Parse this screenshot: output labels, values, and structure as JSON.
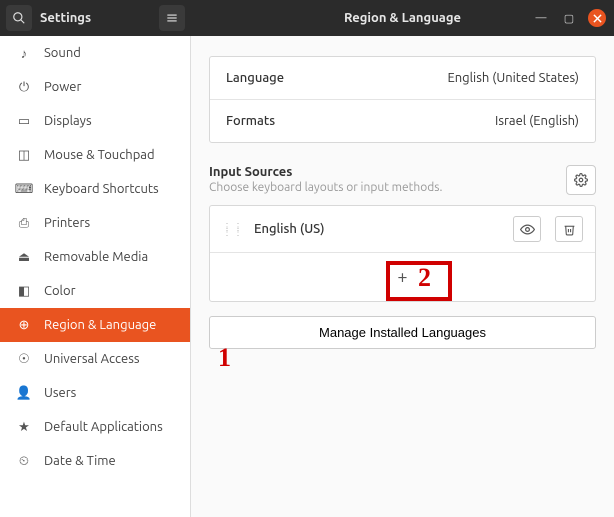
{
  "header": {
    "left_title": "Settings",
    "right_title": "Region & Language"
  },
  "sidebar": {
    "items": [
      {
        "icon": "♪",
        "label": "Sound"
      },
      {
        "icon": "⏻",
        "label": "Power"
      },
      {
        "icon": "▭",
        "label": "Displays"
      },
      {
        "icon": "◫",
        "label": "Mouse & Touchpad"
      },
      {
        "icon": "⌨",
        "label": "Keyboard Shortcuts"
      },
      {
        "icon": "⎙",
        "label": "Printers"
      },
      {
        "icon": "⏏",
        "label": "Removable Media"
      },
      {
        "icon": "◧",
        "label": "Color"
      },
      {
        "icon": "⊕",
        "label": "Region & Language"
      },
      {
        "icon": "☉",
        "label": "Universal Access"
      },
      {
        "icon": "👤",
        "label": "Users"
      },
      {
        "icon": "★",
        "label": "Default Applications"
      },
      {
        "icon": "⏲",
        "label": "Date & Time"
      }
    ],
    "active_index": 8
  },
  "settings": {
    "language": {
      "label": "Language",
      "value": "English (United States)"
    },
    "formats": {
      "label": "Formats",
      "value": "Israel (English)"
    }
  },
  "input_sources": {
    "title": "Input Sources",
    "description": "Choose keyboard layouts or input methods.",
    "items": [
      {
        "name": "English (US)"
      }
    ],
    "add_symbol": "+"
  },
  "manage_button": "Manage Installed Languages",
  "annotations": {
    "one": "1",
    "two": "2"
  },
  "colors": {
    "accent": "#e95420",
    "annotation": "#d00000"
  }
}
